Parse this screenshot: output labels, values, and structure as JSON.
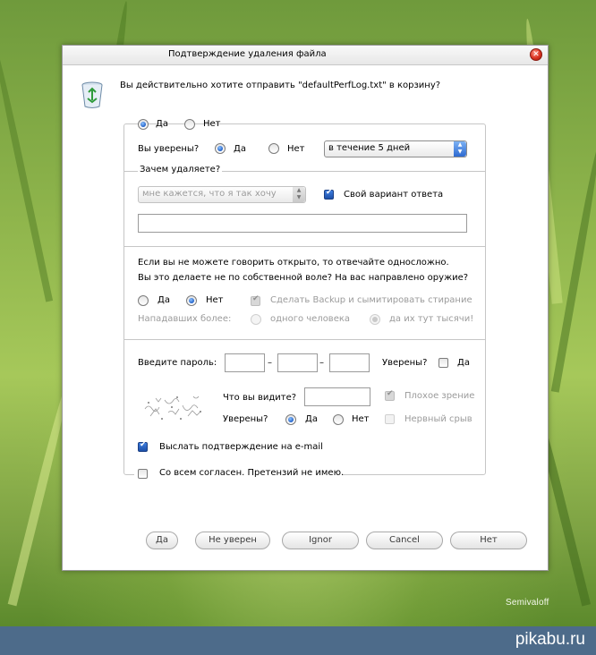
{
  "window": {
    "title": "Подтверждение удаления файла",
    "question": "Вы действительно хотите отправить \"defaultPerfLog.txt\" в  корзину?"
  },
  "top": {
    "yes": "Да",
    "no": "Нет",
    "sure_label": "Вы уверены?",
    "sure_yes": "Да",
    "sure_no": "Нет",
    "when_value": "в течение 5 дней"
  },
  "reason": {
    "heading": "Зачем удаляете?",
    "select_value": "мне кажется, что я так хочу",
    "own_answer": "Свой вариант ответа",
    "own_answer_value": ""
  },
  "weapon": {
    "line1": "Если вы не можете говорить открыто, то отвечайте односложно.",
    "line2": "Вы это делаете не по собственной воле? На вас направлено оружие?",
    "yes": "Да",
    "no": "Нет",
    "backup": "Сделать Backup и сымитировать стирание",
    "attackers_label": "Нападавших более:",
    "one_person": "одного человека",
    "thousands": "да их тут тысячи!"
  },
  "password": {
    "label": "Введите пароль:",
    "dash": "–",
    "sure_label": "Уверены?",
    "sure_yes": "Да",
    "what_see": "Что вы видите?",
    "bad_sight": "Плохое зрение",
    "sure2_label": "Уверены?",
    "sure2_yes": "Да",
    "sure2_no": "Нет",
    "nervous": "Нервный срыв",
    "email": "Выслать подтверждение на e-mail"
  },
  "agree": "Со всем согласен. Претензий не имею.",
  "buttons": {
    "yes": "Да",
    "not_sure": "Не уверен",
    "ignor": "Ignor",
    "cancel": "Cancel",
    "no": "Нет"
  },
  "signature": "Semivaloff",
  "footer": "pikabu.ru",
  "colors": {
    "accent": "#2d6ad1",
    "footer_bar": "#4d6b8a",
    "close_button": "#d9311f"
  }
}
